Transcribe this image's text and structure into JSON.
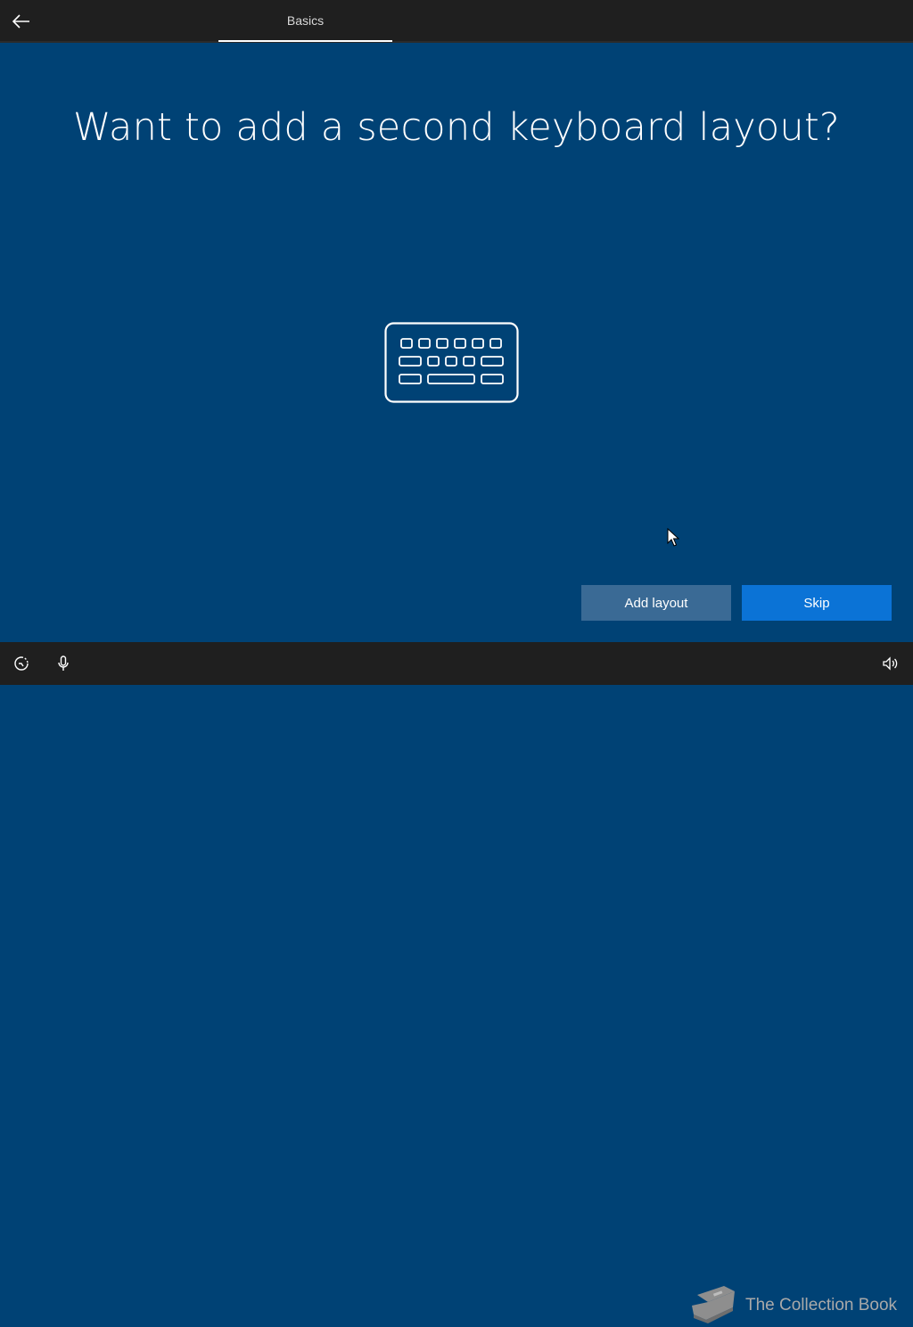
{
  "header": {
    "tab_label": "Basics"
  },
  "main": {
    "title": "Want to add a second keyboard layout?",
    "illustration_icon": "keyboard-icon"
  },
  "actions": {
    "add_layout_label": "Add layout",
    "skip_label": "Skip"
  },
  "footer": {
    "icons": [
      "ease-of-access-icon",
      "microphone-icon",
      "volume-icon"
    ],
    "watermark_text": "The Collection Book"
  },
  "colors": {
    "background": "#004275",
    "bar": "#1f1f1f",
    "add_button": "#3a6a95",
    "skip_button": "#0b73d6"
  }
}
